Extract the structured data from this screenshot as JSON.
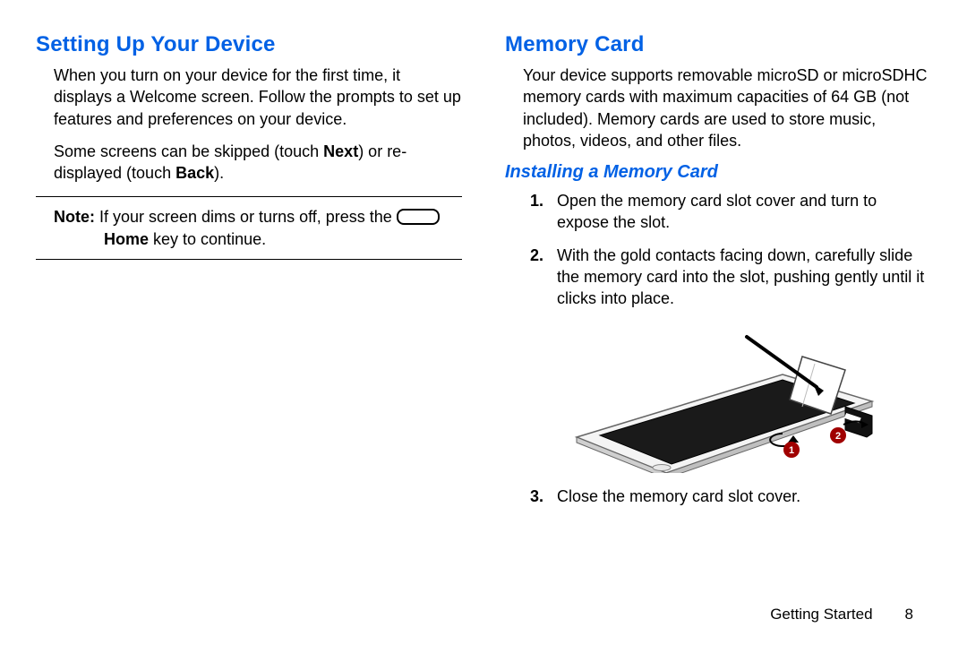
{
  "left": {
    "heading": "Setting Up Your Device",
    "para1_a": "When you turn on your device for the first time, it displays a Welcome screen. Follow the prompts to set up features and preferences on your device.",
    "para2_a": "Some screens can be skipped (touch ",
    "para2_next": "Next",
    "para2_b": ") or re-displayed (touch ",
    "para2_back": "Back",
    "para2_c": ").",
    "note_label": "Note:",
    "note_a": " If your screen dims or turns off, press the ",
    "note_home": "Home",
    "note_b": " key to continue."
  },
  "right": {
    "heading": "Memory Card",
    "intro": "Your device supports removable microSD or microSDHC memory cards with maximum capacities of 64 GB (not included). Memory cards are used to store music, photos, videos, and other files.",
    "sub": "Installing a Memory Card",
    "steps": [
      "Open the memory card slot cover and turn to expose the slot.",
      "With the gold contacts facing down, carefully slide the memory card into the slot, pushing gently until it clicks into place.",
      "Close the memory card slot cover."
    ]
  },
  "footer": {
    "section": "Getting Started",
    "page": "8"
  }
}
